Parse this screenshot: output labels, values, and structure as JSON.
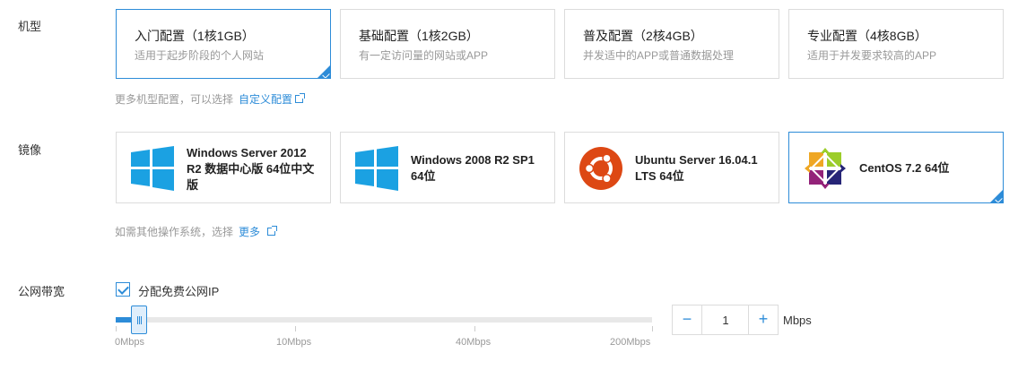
{
  "labels": {
    "model": "机型",
    "image": "镜像",
    "bandwidth": "公网带宽"
  },
  "specs": [
    {
      "title": "入门配置（1核1GB）",
      "desc": "适用于起步阶段的个人网站",
      "selected": true
    },
    {
      "title": "基础配置（1核2GB）",
      "desc": "有一定访问量的网站或APP",
      "selected": false
    },
    {
      "title": "普及配置（2核4GB）",
      "desc": "并发适中的APP或普通数据处理",
      "selected": false
    },
    {
      "title": "专业配置（4核8GB）",
      "desc": "适用于并发要求较高的APP",
      "selected": false
    }
  ],
  "spec_hint": {
    "text": "更多机型配置，可以选择",
    "link": "自定义配置"
  },
  "images": [
    {
      "icon": "windows-icon",
      "title": "Windows Server 2012 R2 数据中心版 64位中文版",
      "selected": false
    },
    {
      "icon": "windows-icon",
      "title": "Windows 2008 R2 SP1 64位",
      "selected": false
    },
    {
      "icon": "ubuntu-icon",
      "title": "Ubuntu Server 16.04.1 LTS 64位",
      "selected": false
    },
    {
      "icon": "centos-icon",
      "title": "CentOS 7.2 64位",
      "selected": true
    }
  ],
  "image_hint": {
    "text": "如需其他操作系统，选择",
    "link": "更多"
  },
  "bandwidth": {
    "checkbox_label": "分配免费公网IP",
    "checked": true,
    "slider_ticks": [
      "0Mbps",
      "10Mbps",
      "40Mbps",
      "200Mbps"
    ],
    "value": "1",
    "minus": "−",
    "plus": "+",
    "unit": "Mbps"
  },
  "colors": {
    "accent": "#2d8cd8",
    "windows": "#1ba1e2",
    "ubuntu": "#dd4814"
  }
}
